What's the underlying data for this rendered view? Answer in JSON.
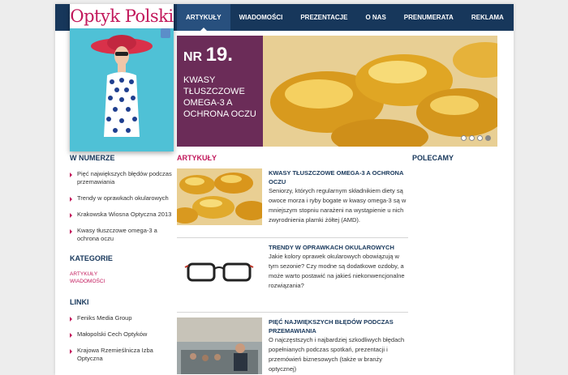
{
  "logo": {
    "title": "Optyk Polski"
  },
  "nav": {
    "items": [
      "ARTYKUŁY",
      "WIADOMOŚCI",
      "PREZENTACJE",
      "O NAS",
      "PRENUMERATA",
      "REKLAMA"
    ]
  },
  "hero": {
    "nr_label": "NR",
    "nr_value": "19.",
    "headline": "KWASY TŁUSZCZOWE OMEGA-3 A OCHRONA OCZU",
    "slide_count": 4,
    "active_slide": 4
  },
  "sidebar": {
    "issue_heading": "W NUMERZE",
    "issue_items": [
      "Pięć największych błędów podczas przemawiania",
      "Trendy w oprawkach okularowych",
      "Krakowska Wiosna Optyczna 2013",
      "Kwasy tłuszczowe omega-3 a ochrona oczu"
    ],
    "categories_heading": "KATEGORIE",
    "categories": [
      "ARTYKUŁY",
      "WIADOMOŚCI"
    ],
    "links_heading": "LINKI",
    "links": [
      "Feniks Media Group",
      "Małopolski Cech Optyków",
      "Krajowa Rzemieślnicza Izba Optyczna"
    ]
  },
  "main": {
    "heading": "ARTYKUŁY",
    "articles": [
      {
        "title": "KWASY TŁUSZCZOWE OMEGA-3 A OCHRONA OCZU",
        "excerpt": "Seniorzy, których regularnym składnikiem diety są owoce morza i ryby bogate w kwasy omega-3 są w mniejszym stopniu narażeni na wystąpienie u nich zwyrodnienia plamki żółtej (AMD)."
      },
      {
        "title": "TRENDY W OPRAWKACH OKULAROWYCH",
        "excerpt": "Jakie kolory oprawek okularowych obowiązują w tym sezonie? Czy modne są dodatkowe ozdoby, a może warto postawić na jakieś niekonwencjonalne rozwiązania?"
      },
      {
        "title": "PIĘĆ NAJWIĘKSZYCH BŁĘDÓW PODCZAS PRZEMAWIANIA",
        "excerpt": "O najczęstszych i najbardziej szkodliwych błędach popełnianych podczas spotkań, prezentacji i przemówień biznesowych (także w branży optycznej)"
      }
    ]
  },
  "right": {
    "heading": "POLECAMY"
  }
}
